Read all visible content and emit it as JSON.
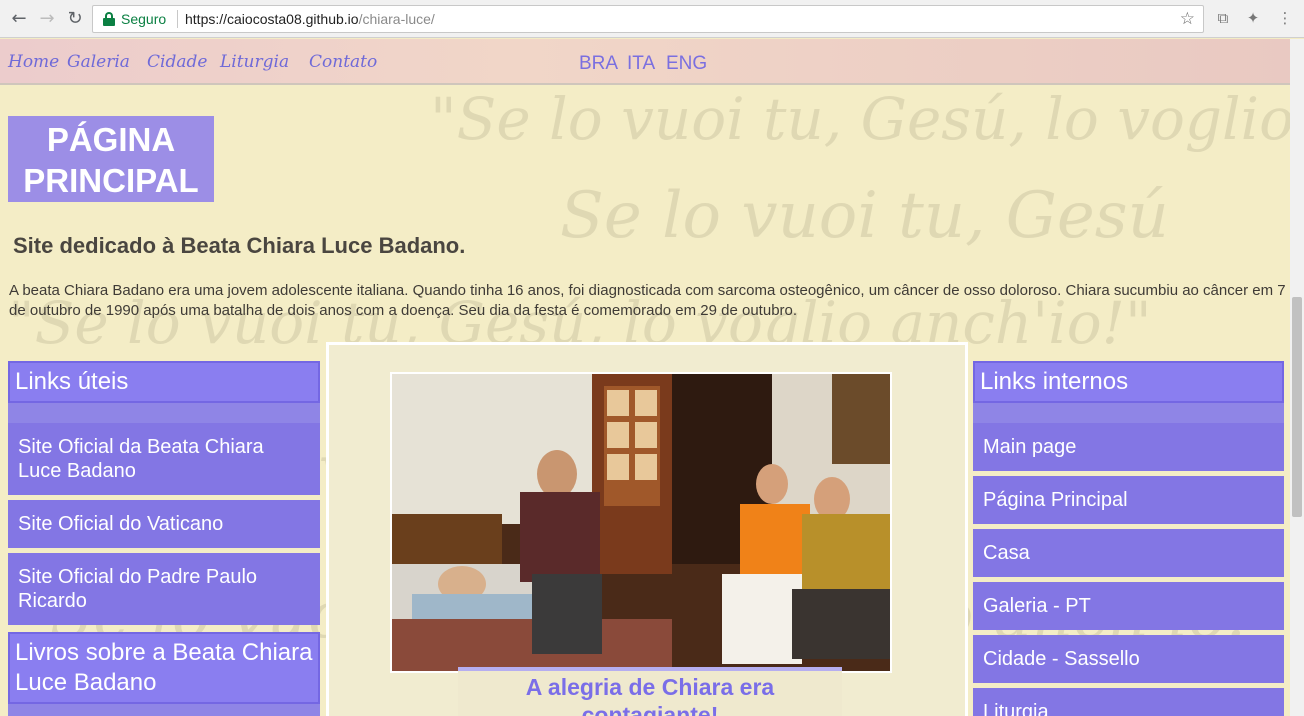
{
  "browser": {
    "secure_label": "Seguro",
    "url_host": "https://caiocosta08.github.io",
    "url_path": "/chiara-luce/",
    "icons": {
      "back": "back-arrow-icon",
      "forward": "forward-arrow-icon",
      "reload": "reload-icon",
      "star": "bookmark-star-icon"
    }
  },
  "background_text": {
    "line": "\"Se lo vuoi tu, Gesú, lo voglio anch'io!\"",
    "line_short": "Se lo vuoi tu, Gesú"
  },
  "nav": {
    "items": [
      "Home",
      "Galeria",
      "Cidade",
      "Liturgia",
      "Contato"
    ],
    "languages": [
      "BRA",
      "ITA",
      "ENG"
    ]
  },
  "header": {
    "title_line1": "PÁGINA",
    "title_line2": "PRINCIPAL",
    "subtitle": "Site dedicado à Beata Chiara Luce Badano.",
    "intro": "A beata Chiara Badano era uma jovem adolescente italiana. Quando tinha 16 anos, foi diagnosticada com sarcoma osteogênico, um câncer de osso doloroso. Chiara sucumbiu ao câncer em 7 de outubro de 1990 após uma batalha de dois anos com a doença. Seu dia da festa é comemorado em 29 de outubro."
  },
  "left_sidebar": {
    "title": "Links úteis",
    "items": [
      "Site Oficial da Beata Chiara Luce Badano",
      "Site Oficial do Vaticano",
      "Site Oficial do Padre Paulo Ricardo"
    ],
    "books_title": "Livros sobre a Beata Chiara Luce Badano"
  },
  "right_sidebar": {
    "title": "Links internos",
    "items": [
      "Main page",
      "Página Principal",
      "Casa",
      "Galeria - PT",
      "Cidade - Sassello",
      "Liturgia"
    ]
  },
  "center": {
    "caption": "A alegria de Chiara era contagiante!"
  },
  "colors": {
    "accent": "#8376e4",
    "nav_text": "#6f6ad8",
    "page_bg": "#f4edc6"
  }
}
